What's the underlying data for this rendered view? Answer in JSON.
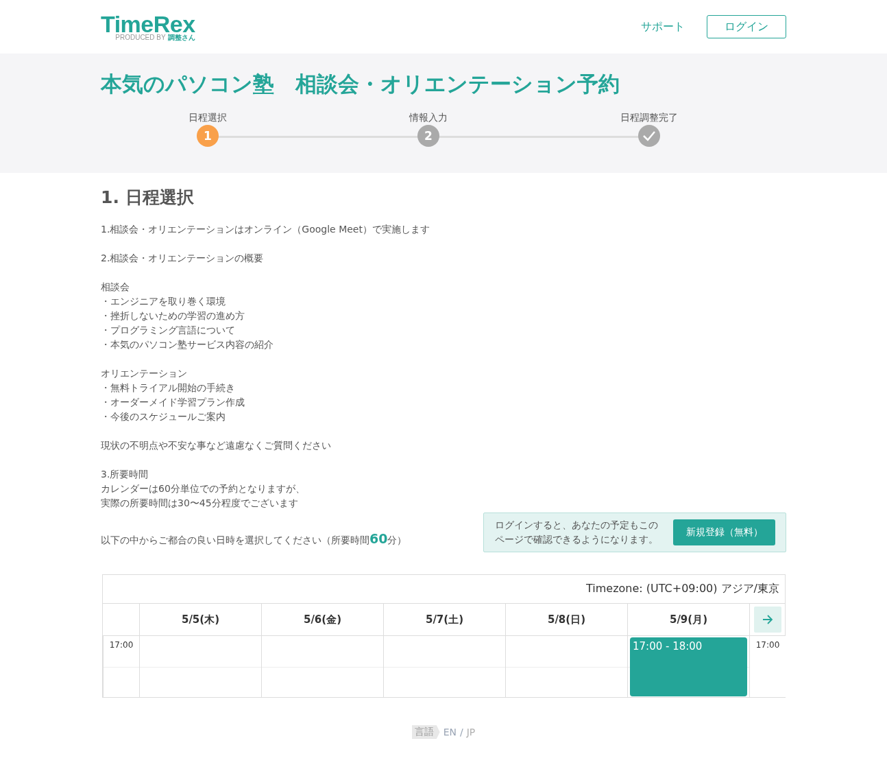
{
  "header": {
    "logo": "TimeRex",
    "logo_sub": "PRODUCED BY",
    "logo_brand": "調整さん",
    "nav": [
      {
        "label": "サポート",
        "kind": "link"
      },
      {
        "label": "ログイン",
        "kind": "outline"
      }
    ]
  },
  "title": "本気のパソコン塾　相談会・オリエンテーション予約",
  "steps": [
    {
      "label": "日程選択",
      "kind": "number",
      "marker": "1",
      "selected": true
    },
    {
      "label": "情報入力",
      "kind": "number",
      "marker": "2",
      "selected": false
    },
    {
      "label": "日程調整完了",
      "kind": "check",
      "selected": false
    }
  ],
  "section_heading": "1. 日程選択",
  "description": [
    [
      "1.相談会・オリエンテーションはオンライン（Google Meet）で実施します"
    ],
    [
      "2.相談会・オリエンテーションの概要"
    ],
    [
      "相談会",
      "・エンジニアを取り巻く環境",
      "・挫折しないための学習の進め方",
      "・プログラミング言語について",
      "・本気のパソコン塾サービス内容の紹介"
    ],
    [
      "オリエンテーション",
      "・無料トライアル開始の手続き",
      "・オーダーメイド学習プラン作成",
      "・今後のスケジュールご案内"
    ],
    [
      "現状の不明点や不安な事など遠慮なくご質問ください"
    ],
    [
      "3.所要時間",
      "カレンダーは60分単位での予約となりますが、",
      "実際の所要時間は30〜45分程度でございます"
    ]
  ],
  "prompt": "以下の中からご都合の良い日時を選択してください（所要時間**60**分）",
  "login_notice": {
    "text": "ログインすると、あなたの予定もこのページで確認できるようになります。",
    "button": "新規登録（無料）"
  },
  "calendar": {
    "timezone": "Timezone: (UTC+09:00) アジア/東京",
    "days": [
      {
        "label": "5/5(木)"
      },
      {
        "label": "5/6(金)"
      },
      {
        "label": "5/7(土)"
      },
      {
        "label": "5/8(日)"
      },
      {
        "label": "5/9(月)",
        "slot": "17:00 - 18:00"
      }
    ],
    "time_left": "17:00",
    "time_right": "17:00"
  },
  "footer": {
    "language_label": "言語",
    "separator": "/",
    "options": [
      {
        "label": "EN",
        "selected": false
      },
      {
        "label": "JP",
        "selected": true
      }
    ]
  }
}
